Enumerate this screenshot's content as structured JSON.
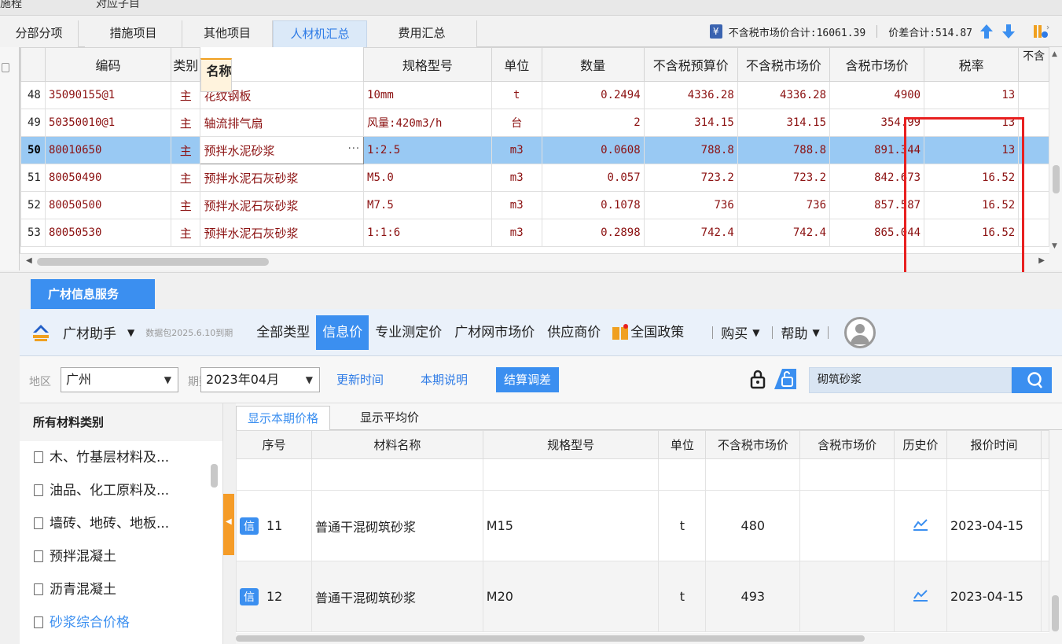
{
  "topstrip": {
    "left": "施程",
    "right": "对应子目"
  },
  "tabs": [
    "分部分项",
    "措施项目",
    "其他项目",
    "人材机汇总",
    "费用汇总"
  ],
  "summary": {
    "pretax_total": "不含税市场价合计:16061.39",
    "diff_total": "价差合计:514.87"
  },
  "grid": {
    "headers": [
      "",
      "编码",
      "类别",
      "名称",
      "规格型号",
      "单位",
      "数量",
      "不含税预算价",
      "不含税市场价",
      "含税市场价",
      "税率",
      "不含"
    ],
    "rows": [
      {
        "no": "48",
        "code": "35090155@1",
        "cat": "主",
        "name": "花纹钢板",
        "spec": "10mm",
        "unit": "t",
        "qty": "0.2494",
        "budget": "4336.28",
        "market": "4336.28",
        "taxed": "4900",
        "rate": "13"
      },
      {
        "no": "49",
        "code": "50350010@1",
        "cat": "主",
        "name": "轴流排气扇",
        "spec": "风量:420m3/h",
        "unit": "台",
        "qty": "2",
        "budget": "314.15",
        "market": "314.15",
        "taxed": "354.99",
        "rate": "13"
      },
      {
        "no": "50",
        "code": "80010650",
        "cat": "主",
        "name": "预拌水泥砂浆",
        "spec": "1:2.5",
        "unit": "m3",
        "qty": "0.0608",
        "budget": "788.8",
        "market": "788.8",
        "taxed": "891.344",
        "rate": "13"
      },
      {
        "no": "51",
        "code": "80050490",
        "cat": "主",
        "name": "预拌水泥石灰砂浆",
        "spec": "M5.0",
        "unit": "m3",
        "qty": "0.057",
        "budget": "723.2",
        "market": "723.2",
        "taxed": "842.673",
        "rate": "16.52"
      },
      {
        "no": "52",
        "code": "80050500",
        "cat": "主",
        "name": "预拌水泥石灰砂浆",
        "spec": "M7.5",
        "unit": "m3",
        "qty": "0.1078",
        "budget": "736",
        "market": "736",
        "taxed": "857.587",
        "rate": "16.52"
      },
      {
        "no": "53",
        "code": "80050530",
        "cat": "主",
        "name": "预拌水泥石灰砂浆",
        "spec": "1:1:6",
        "unit": "m3",
        "qty": "0.2898",
        "budget": "742.4",
        "market": "742.4",
        "taxed": "865.044",
        "rate": "16.52"
      }
    ],
    "selected_row": "50"
  },
  "service": {
    "tab": "广材信息服务",
    "assistant": "广材助手",
    "package_note": "数据包2025.6.10到期",
    "nav": [
      "全部类型",
      "信息价",
      "专业测定价",
      "广材网市场价",
      "供应商价",
      "全国政策"
    ],
    "buy": "购买",
    "help": "帮助"
  },
  "filter": {
    "region_label": "地区",
    "region": "广州",
    "period_label": "期数",
    "period": "2023年04月",
    "update_time": "更新时间",
    "period_note": "本期说明",
    "settle": "结算调差",
    "search": "砌筑砂浆"
  },
  "sidebar": {
    "title": "所有材料类别",
    "items": [
      "木、竹基层材料及...",
      "油品、化工原料及...",
      "墙砖、地砖、地板...",
      "预拌混凝土",
      "沥青混凝土",
      "砂浆综合价格"
    ]
  },
  "lower": {
    "tabs": [
      "显示本期价格",
      "显示平均价"
    ],
    "headers": [
      "序号",
      "材料名称",
      "规格型号",
      "单位",
      "不含税市场价",
      "含税市场价",
      "历史价",
      "报价时间"
    ],
    "badge": "信",
    "rows": [
      {
        "no": "11",
        "name": "普通干混砌筑砂浆",
        "spec": "M15",
        "unit": "t",
        "price": "480",
        "taxed": "",
        "date": "2023-04-15"
      },
      {
        "no": "12",
        "name": "普通干混砌筑砂浆",
        "spec": "M20",
        "unit": "t",
        "price": "493",
        "taxed": "",
        "date": "2023-04-15"
      }
    ]
  },
  "colors": {
    "accent": "#3b8ff0",
    "selected_row": "#99c9f3",
    "highlight_box": "#e82020",
    "data_text": "#8b1010"
  }
}
